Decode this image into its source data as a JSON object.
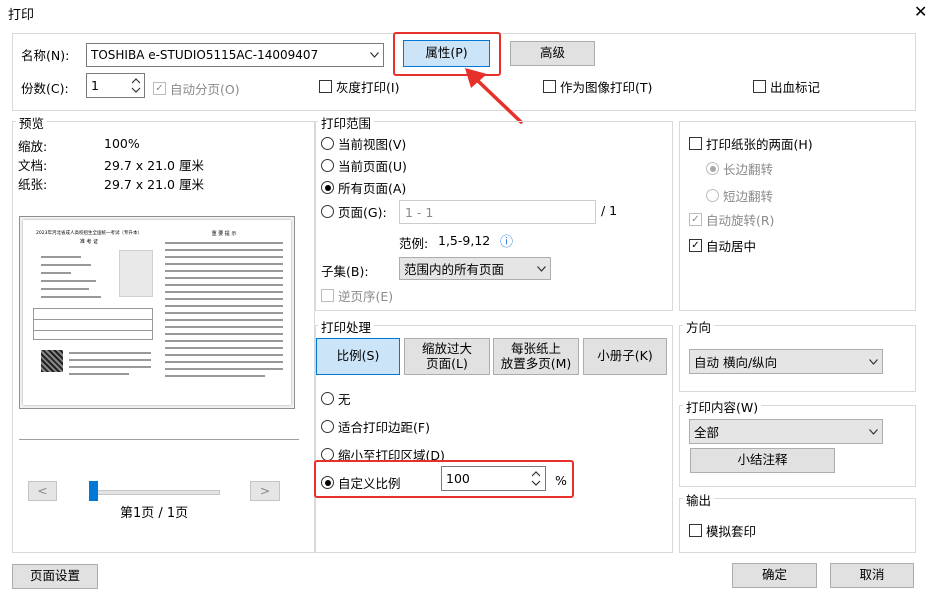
{
  "window": {
    "title": "打印",
    "close_glyph": "✕"
  },
  "printer": {
    "name_label": "名称(N):",
    "name_value": "TOSHIBA e-STUDIO5115AC-14009407",
    "properties_button": "属性(P)",
    "advanced_button": "高级",
    "copies_label": "份数(C):",
    "copies_value": "1",
    "collate_label": "自动分页(O)",
    "collate_checked": true,
    "grayscale_label": "灰度打印(I)",
    "grayscale_checked": false,
    "print_as_image_label": "作为图像打印(T)",
    "print_as_image_checked": false,
    "bleed_marks_label": "出血标记",
    "bleed_marks_checked": false
  },
  "preview": {
    "title": "预览",
    "zoom_label": "缩放:",
    "zoom_value": "100%",
    "document_label": "文档:",
    "document_value": "29.7 x 21.0 厘米",
    "paper_label": "纸张:",
    "paper_value": "29.7 x 21.0 厘米",
    "thumb_left_title": "2023年河北省成人高校招生全国统一考试（专升本）",
    "thumb_left_subtitle": "准 考 证",
    "thumb_right_title": "重 要 提 示",
    "prev_button": "<",
    "next_button": ">",
    "page_indicator": "第1页 / 1页"
  },
  "print_range": {
    "title": "打印范围",
    "current_view": "当前视图(V)",
    "current_page": "当前页面(U)",
    "all_pages": "所有页面(A)",
    "pages": "页面(G):",
    "pages_value": "1 - 1",
    "pages_total": "/ 1",
    "example_label": "范例:",
    "example_value": "1,5-9,12",
    "info_icon": "ⓘ",
    "subset_label": "子集(B):",
    "subset_value": "范围内的所有页面",
    "reverse_label": "逆页序(E)",
    "selected": "all_pages"
  },
  "print_handling": {
    "title": "打印处理",
    "tabs": [
      "比例(S)",
      "缩放过大页面(L)",
      "每张纸上放置多页(M)",
      "小册子(K)"
    ],
    "active_tab": 0,
    "tab_lines": [
      [
        "比例(S)"
      ],
      [
        "缩放过大",
        "页面(L)"
      ],
      [
        "每张纸上",
        "放置多页(M)"
      ],
      [
        "小册子(K)"
      ]
    ],
    "none": "无",
    "fit_margins": "适合打印边距(F)",
    "shrink": "缩小至打印区域(D)",
    "custom_scale": "自定义比例",
    "custom_scale_value": "100",
    "percent": "%",
    "selected": "custom_scale"
  },
  "duplex": {
    "both_sides": "打印纸张的两面(H)",
    "both_sides_checked": false,
    "long_edge": "长边翻转",
    "short_edge": "短边翻转",
    "auto_rotate": "自动旋转(R)",
    "auto_rotate_checked": true,
    "auto_center": "自动居中",
    "auto_center_checked": true
  },
  "orientation": {
    "title": "方向",
    "value": "自动 横向/纵向"
  },
  "content": {
    "title": "打印内容(W)",
    "value": "全部",
    "summary_button": "小结注释"
  },
  "output": {
    "title": "输出",
    "simulate_overprint": "模拟套印",
    "simulate_overprint_checked": false
  },
  "footer": {
    "page_setup": "页面设置",
    "ok": "确定",
    "cancel": "取消"
  },
  "colors": {
    "accent": "#0078d7",
    "annotation_red": "#e8302a",
    "button_bg": "#e1e1e1",
    "selected_tab": "#cce4f7"
  }
}
